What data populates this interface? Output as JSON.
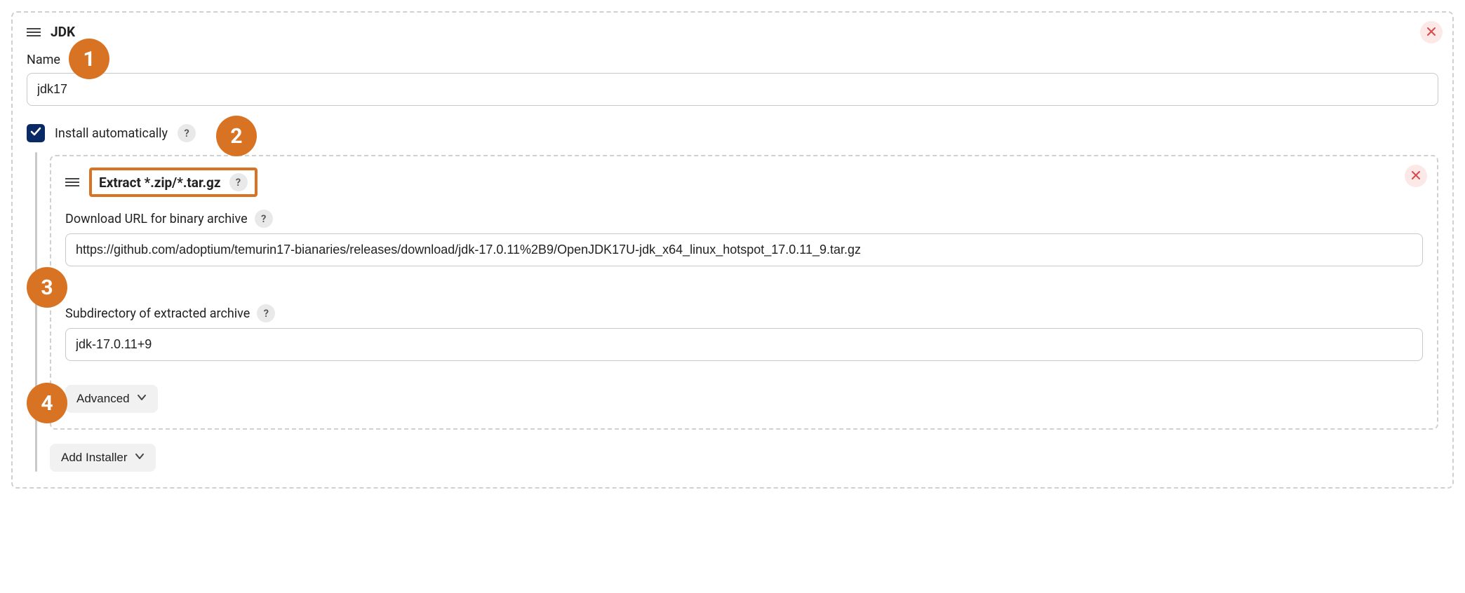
{
  "panel": {
    "title": "JDK",
    "name_label": "Name",
    "name_value": "jdk17",
    "install_auto_label": "Install automatically"
  },
  "installer": {
    "title": "Extract *.zip/*.tar.gz",
    "download_label": "Download URL for binary archive",
    "download_value": "https://github.com/adoptium/temurin17-bianaries/releases/download/jdk-17.0.11%2B9/OpenJDK17U-jdk_x64_linux_hotspot_17.0.11_9.tar.gz",
    "subdir_label": "Subdirectory of extracted archive",
    "subdir_value": "jdk-17.0.11+9",
    "advanced_label": "Advanced",
    "add_installer_label": "Add Installer"
  },
  "help_glyph": "?",
  "annotations": {
    "a1": "1",
    "a2": "2",
    "a3": "3",
    "a4": "4"
  },
  "colors": {
    "accent_orange": "#d97324",
    "checkbox_bg": "#0a2a66",
    "close_bg": "#fde8e8",
    "close_fg": "#d94a4a"
  }
}
